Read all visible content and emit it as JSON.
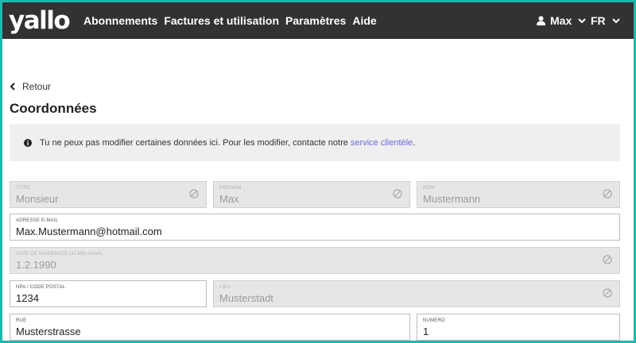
{
  "header": {
    "logo": "yallo",
    "nav": [
      "Abonnements",
      "Factures et utilisation",
      "Paramètres",
      "Aide"
    ],
    "user": "Max",
    "language": "FR"
  },
  "back_label": "Retour",
  "title": "Coordonnées",
  "notice": {
    "text": "Tu ne peux pas modifier certaines données ici. Pour les modifier, contacte notre",
    "link": "service clientèle",
    "end": "."
  },
  "fields": {
    "titre": {
      "label": "TITRE",
      "value": "Monsieur"
    },
    "prenom": {
      "label": "PRENOM",
      "value": "Max"
    },
    "nom": {
      "label": "NOM",
      "value": "Mustermann"
    },
    "email": {
      "label": "ADRESSE E-MAIL",
      "value": "Max.Mustermann@hotmail.com"
    },
    "dob": {
      "label": "DATE DE NAISSANCE (JJ.MM.AAAA)",
      "value": "1.2.1990"
    },
    "npa": {
      "label": "NPA / CODE POSTAL",
      "value": "1234"
    },
    "lieu": {
      "label": "LIEU",
      "value": "Musterstadt"
    },
    "rue": {
      "label": "RUE",
      "value": "Musterstrasse"
    },
    "numero": {
      "label": "NUMERO",
      "value": "1"
    }
  },
  "colors": {
    "accent": "#1fb8ad",
    "header_bg": "#323232",
    "link": "#6a6ad6"
  }
}
